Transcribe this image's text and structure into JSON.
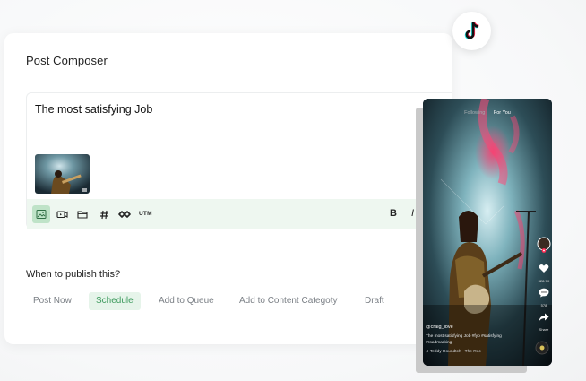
{
  "composer": {
    "title": "Post Composer",
    "post_text": "The most satisfying Job",
    "toolbar": {
      "icons": [
        "image-icon",
        "video-icon",
        "folder-icon",
        "hashtag-icon",
        "link-icon"
      ],
      "utm_label": "UTM",
      "bold_label": "B",
      "italic_label": "I"
    }
  },
  "publish": {
    "label": "When to publish this?",
    "options": [
      "Post Now",
      "Schedule",
      "Add to Queue",
      "Add to Content Categoty",
      "Draft"
    ],
    "selected": "Schedule"
  },
  "preview": {
    "platform_icon": "tiktok-icon",
    "tabs": {
      "following": "Following",
      "for_you": "For You"
    },
    "username": "@craig_love",
    "caption": "The most satisfying Job #fyp #satisfying #roadmarking",
    "music": "Teddy Roundtch - The Roc",
    "likes": "328.7K",
    "comments": "578",
    "share_label": "Share"
  },
  "colors": {
    "accent_green": "#3d9a5d",
    "toolbar_bg": "#eef7f0",
    "selected_bg": "#e6f4ea"
  }
}
